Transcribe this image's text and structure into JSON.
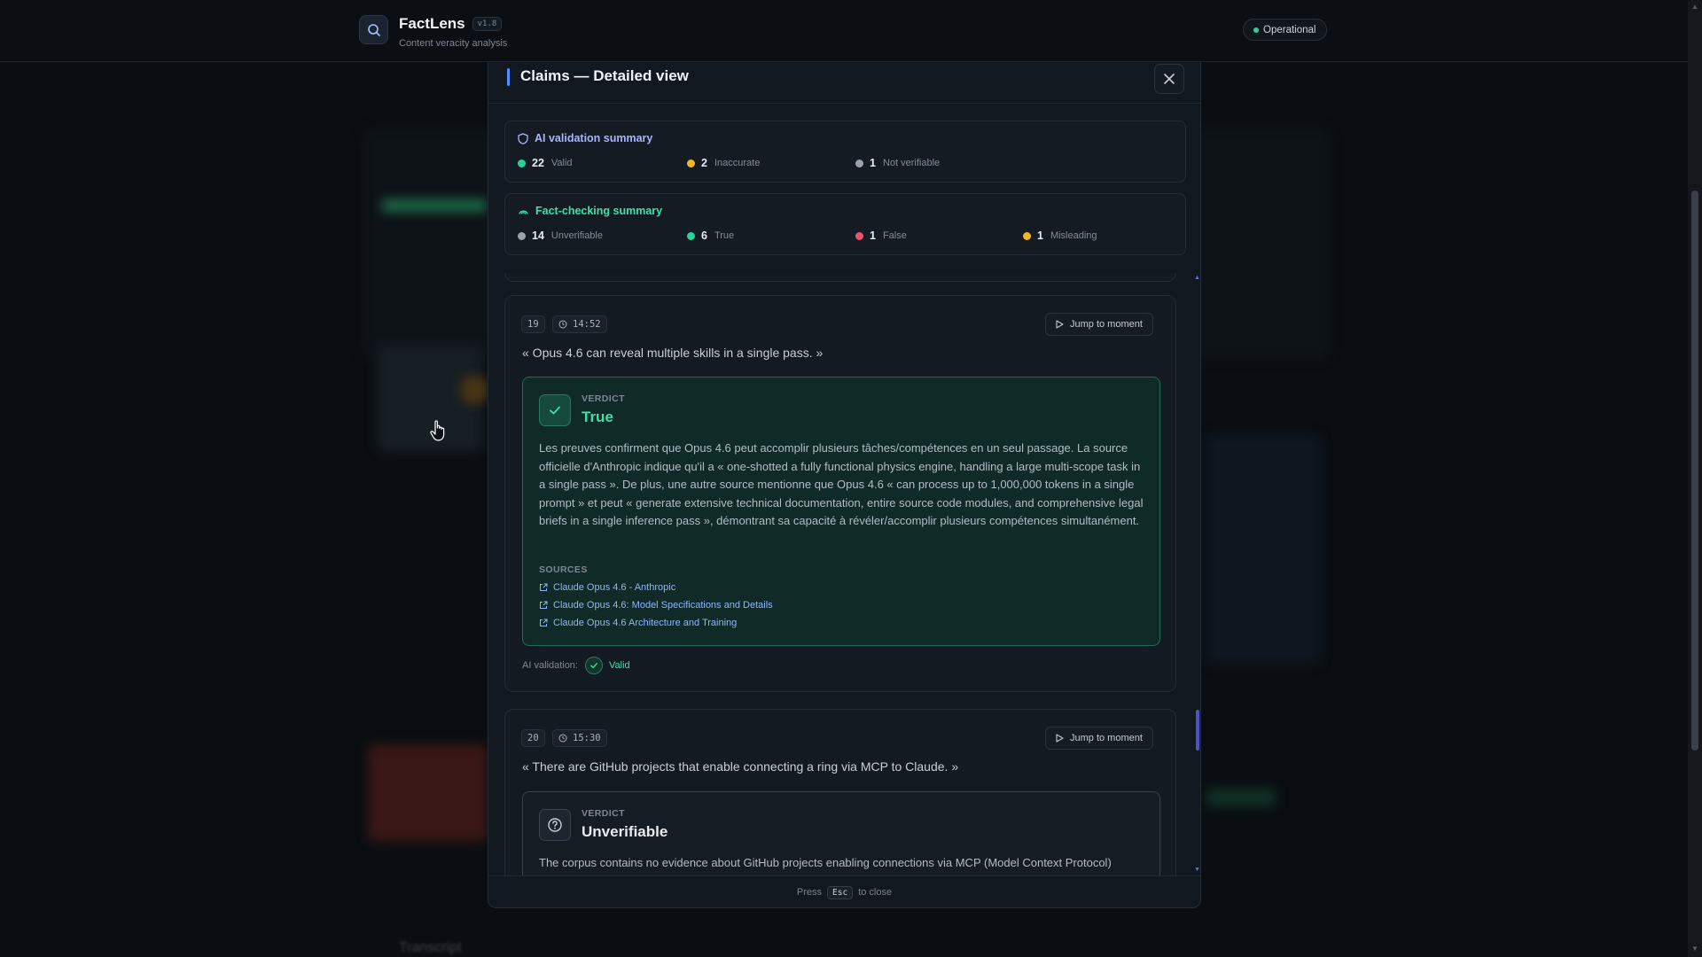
{
  "app": {
    "name": "FactLens",
    "version": "v1.8",
    "subtitle": "Content veracity analysis",
    "status": "Operational"
  },
  "background": {
    "transcript_label": "Transcript"
  },
  "modal": {
    "title": "Claims — Detailed view",
    "ai_summary": {
      "title": "AI validation summary",
      "stats": [
        {
          "count": "22",
          "label": "Valid",
          "color": "#2bd39b"
        },
        {
          "count": "2",
          "label": "Inaccurate",
          "color": "#f3b62a"
        },
        {
          "count": "1",
          "label": "Not verifiable",
          "color": "#9aa3ad"
        }
      ]
    },
    "fact_summary": {
      "title": "Fact-checking summary",
      "stats": [
        {
          "count": "14",
          "label": "Unverifiable",
          "color": "#9aa3ad"
        },
        {
          "count": "6",
          "label": "True",
          "color": "#2bd39b"
        },
        {
          "count": "1",
          "label": "False",
          "color": "#f0506e"
        },
        {
          "count": "1",
          "label": "Misleading",
          "color": "#f3b62a"
        }
      ]
    },
    "claims": [
      {
        "number": "19",
        "time": "14:52",
        "jump_label": "Jump to moment",
        "quote": "« Opus 4.6 can reveal multiple skills in a single pass. »",
        "verdict_label": "VERDICT",
        "verdict": "True",
        "explanation": "Les preuves confirment que Opus 4.6 peut accomplir plusieurs tâches/compétences en un seul passage. La source officielle d'Anthropic indique qu'il a « one-shotted a fully functional physics engine, handling a large multi-scope task in a single pass ». De plus, une autre source mentionne que Opus 4.6 « can process up to 1,000,000 tokens in a single prompt » et peut « generate extensive technical documentation, entire source code modules, and comprehensive legal briefs in a single inference pass », démontrant sa capacité à révéler/accomplir plusieurs compétences simultanément.",
        "sources_label": "SOURCES",
        "sources": [
          "Claude Opus 4.6 - Anthropic",
          "Claude Opus 4.6: Model Specifications and Details",
          "Claude Opus 4.6 Architecture and Training"
        ],
        "ai_validation_label": "AI validation:",
        "ai_validation": "Valid"
      },
      {
        "number": "20",
        "time": "15:30",
        "jump_label": "Jump to moment",
        "quote": "« There are GitHub projects that enable connecting a ring via MCP to Claude. »",
        "verdict_label": "VERDICT",
        "verdict": "Unverifiable",
        "explanation": "The corpus contains no evidence about GitHub projects enabling connections via MCP (Model Context Protocol)"
      }
    ],
    "footer": {
      "press": "Press",
      "key": "Esc",
      "to_close": "to close"
    }
  }
}
